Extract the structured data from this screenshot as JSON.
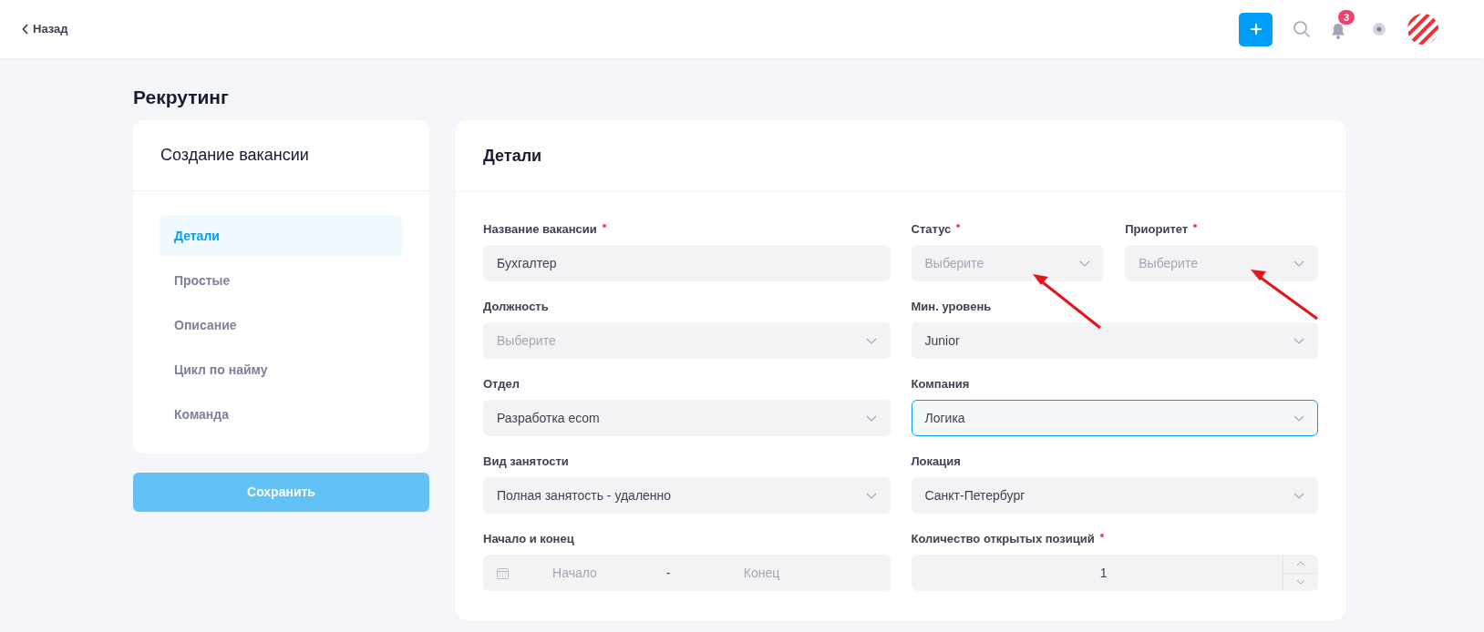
{
  "topbar": {
    "back": "Назад",
    "notifications_badge": "3"
  },
  "page_title": "Рекрутинг",
  "sidebar": {
    "title": "Создание вакансии",
    "items": [
      {
        "label": "Детали",
        "selected": true
      },
      {
        "label": "Простые",
        "selected": false
      },
      {
        "label": "Описание",
        "selected": false
      },
      {
        "label": "Цикл по найму",
        "selected": false
      },
      {
        "label": "Команда",
        "selected": false
      }
    ],
    "save_button": "Сохранить"
  },
  "form": {
    "title": "Детали",
    "rows": [
      [
        {
          "kind": "text",
          "label": "Название вакансии",
          "required": true,
          "value": "Бухгалтер",
          "focused": false
        },
        {
          "kind": "select",
          "label": "Статус",
          "required": true,
          "placeholder": "Выберите",
          "focused": false
        },
        {
          "kind": "select",
          "label": "Приоритет",
          "required": true,
          "placeholder": "Выберите",
          "focused": false
        }
      ],
      [
        {
          "kind": "select",
          "label": "Должность",
          "required": false,
          "placeholder": "Выберите",
          "focused": false
        },
        {
          "kind": "select",
          "label": "Мин. уровень",
          "required": false,
          "value": "Junior",
          "focused": false
        }
      ],
      [
        {
          "kind": "select",
          "label": "Отдел",
          "required": false,
          "value": "Разработка ecom",
          "focused": false
        },
        {
          "kind": "select",
          "label": "Компания",
          "required": false,
          "value": "Логика",
          "focused": true
        }
      ],
      [
        {
          "kind": "select",
          "label": "Вид занятости",
          "required": false,
          "value": "Полная занятость - удаленно",
          "focused": false
        },
        {
          "kind": "select",
          "label": "Локация",
          "required": false,
          "value": "Санкт-Петербург",
          "focused": false
        }
      ],
      [
        {
          "kind": "daterange",
          "label": "Начало и конец",
          "required": false,
          "start_placeholder": "Начало",
          "separator": "-",
          "end_placeholder": "Конец",
          "focused": false
        },
        {
          "kind": "number",
          "label": "Количество открытых позиций",
          "required": true,
          "value": "1",
          "focused": false
        }
      ]
    ]
  }
}
